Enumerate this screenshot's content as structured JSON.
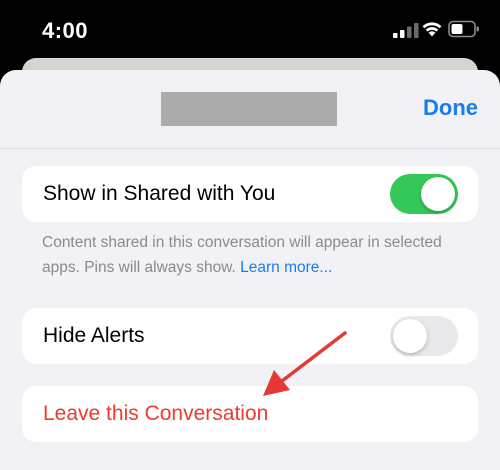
{
  "status_bar": {
    "time": "4:00",
    "icons": [
      "signal-icon",
      "wifi-icon",
      "battery-icon"
    ]
  },
  "header": {
    "title_redacted": true,
    "done_label": "Done"
  },
  "settings": {
    "show_in_shared": {
      "label": "Show in Shared with You",
      "enabled": true
    },
    "shared_footnote": {
      "text": "Content shared in this conversation will appear in selected apps. Pins will always show. ",
      "link_label": "Learn more..."
    },
    "hide_alerts": {
      "label": "Hide Alerts",
      "enabled": false
    },
    "leave_conversation": {
      "label": "Leave this Conversation"
    }
  },
  "colors": {
    "accent": "#1a7cf0",
    "toggle_on": "#34c759",
    "destructive": "#ef3a30",
    "annotation_arrow": "#e53935"
  }
}
